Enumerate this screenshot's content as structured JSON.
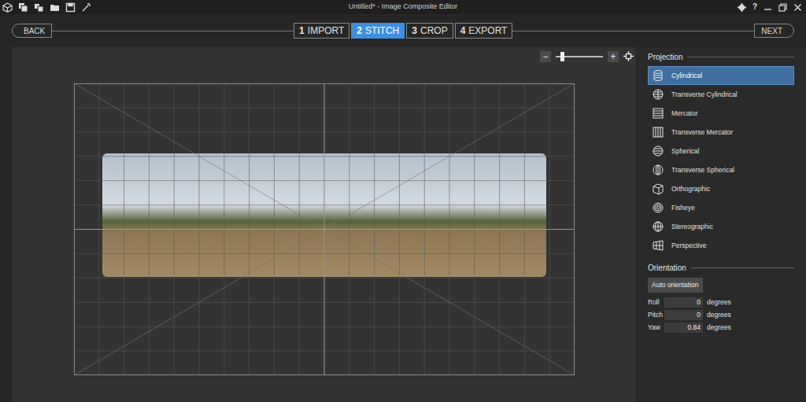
{
  "window": {
    "title": "Untitled* - Image Composite Editor",
    "help": "?"
  },
  "nav": {
    "back": "BACK",
    "next": "NEXT"
  },
  "steps": [
    {
      "number": "1",
      "label": "IMPORT",
      "selected": false
    },
    {
      "number": "2",
      "label": "STITCH",
      "selected": true
    },
    {
      "number": "3",
      "label": "CROP",
      "selected": false
    },
    {
      "number": "4",
      "label": "EXPORT",
      "selected": false
    }
  ],
  "zoom": {
    "minus": "−",
    "plus": "+",
    "level": 0.1
  },
  "projection": {
    "title": "Projection",
    "items": [
      {
        "label": "Cylindrical",
        "selected": true
      },
      {
        "label": "Transverse Cylindrical",
        "selected": false
      },
      {
        "label": "Mercator",
        "selected": false
      },
      {
        "label": "Transverse Mercator",
        "selected": false
      },
      {
        "label": "Spherical",
        "selected": false
      },
      {
        "label": "Transverse Spherical",
        "selected": false
      },
      {
        "label": "Orthographic",
        "selected": false
      },
      {
        "label": "Fisheye",
        "selected": false
      },
      {
        "label": "Stereographic",
        "selected": false
      },
      {
        "label": "Perspective",
        "selected": false
      }
    ]
  },
  "orientation": {
    "title": "Orientation",
    "button": "Auto orientation",
    "fields": [
      {
        "label": "Roll",
        "value": "0",
        "unit": "degrees"
      },
      {
        "label": "Pitch",
        "value": "0",
        "unit": "degrees"
      },
      {
        "label": "Yaw",
        "value": "0.84",
        "unit": "degrees"
      }
    ]
  }
}
